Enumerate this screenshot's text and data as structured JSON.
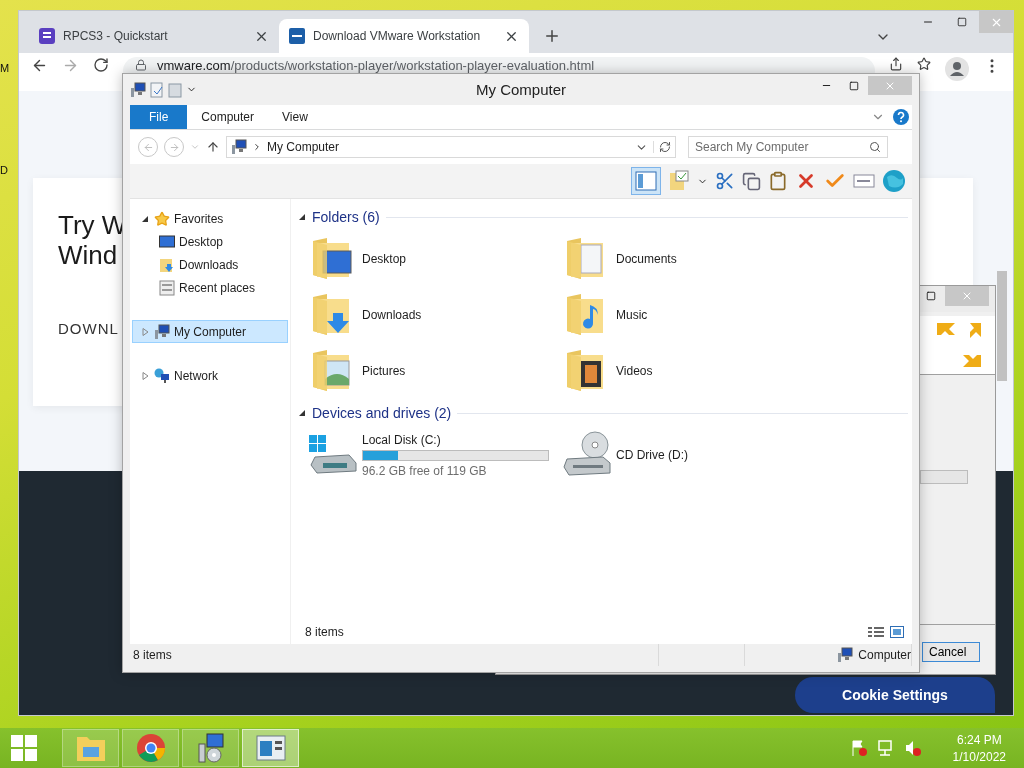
{
  "desktop_labels": [
    "M",
    "D"
  ],
  "browser": {
    "tabs": [
      {
        "title": "RPCS3 - Quickstart",
        "selected": false
      },
      {
        "title": "Download VMware Workstation",
        "selected": true
      }
    ],
    "url": {
      "domain": "vmware.com",
      "path": "/products/workstation-player/workstation-player-evaluation.html"
    },
    "page": {
      "heading_lines": [
        "Try W",
        "Wind"
      ],
      "link": "DOWNL",
      "cookie_button": "Cookie Settings"
    }
  },
  "installer": {
    "button": "Cancel"
  },
  "explorer": {
    "title": "My Computer",
    "ribbon_tabs": [
      {
        "label": "File",
        "selected": true
      },
      {
        "label": "Computer",
        "selected": false
      },
      {
        "label": "View",
        "selected": false
      }
    ],
    "address": "My Computer",
    "search": {
      "placeholder": "Search My Computer"
    },
    "preview_pane": {
      "on": true
    },
    "nav": [
      {
        "label": "Favorites",
        "expanded": true,
        "selected": false,
        "children": [
          {
            "label": "Desktop",
            "selected": false
          },
          {
            "label": "Downloads",
            "selected": false
          },
          {
            "label": "Recent places",
            "selected": false
          }
        ]
      },
      {
        "label": "My Computer",
        "expanded": false,
        "selected": true
      },
      {
        "label": "Network",
        "expanded": false,
        "selected": false
      }
    ],
    "groups": [
      {
        "title": "Folders (6)",
        "expanded": true,
        "items": [
          {
            "name": "Desktop",
            "kind": "folder"
          },
          {
            "name": "Documents",
            "kind": "folder"
          },
          {
            "name": "Downloads",
            "kind": "folder"
          },
          {
            "name": "Music",
            "kind": "folder"
          },
          {
            "name": "Pictures",
            "kind": "folder"
          },
          {
            "name": "Videos",
            "kind": "folder"
          }
        ]
      },
      {
        "title": "Devices and drives (2)",
        "expanded": true,
        "items": [
          {
            "name": "Local Disk (C:)",
            "kind": "disk",
            "level": 0.19,
            "free": "96.2 GB free of 119 GB"
          },
          {
            "name": "CD Drive (D:)",
            "kind": "cd"
          }
        ]
      }
    ],
    "item_count": "8 items",
    "status": {
      "count": "8 items",
      "location": "Computer"
    }
  },
  "taskbar": {
    "apps": [
      {
        "selected": false
      },
      {
        "selected": false
      },
      {
        "selected": false
      },
      {
        "selected": true
      }
    ],
    "clock": {
      "time": "6:24 PM",
      "date": "1/10/2022"
    }
  }
}
